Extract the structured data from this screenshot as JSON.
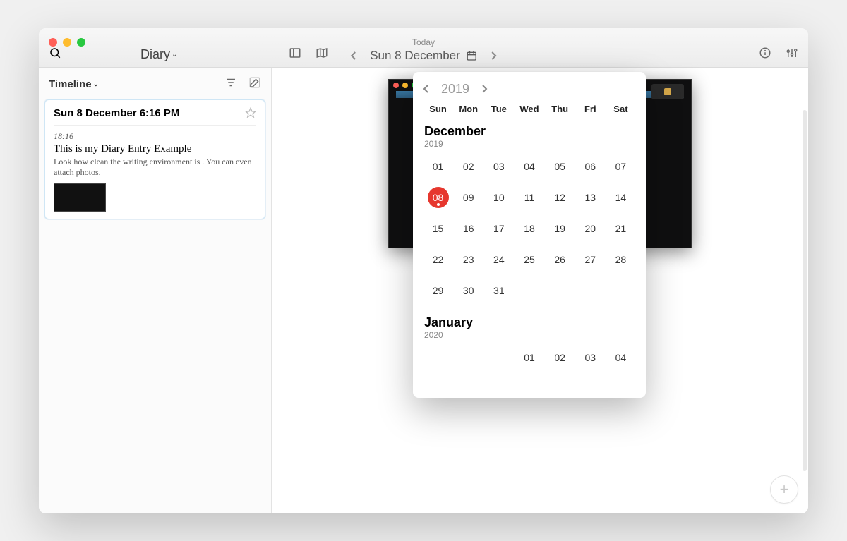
{
  "toolbar": {
    "diary_label": "Diary",
    "today_label": "Today",
    "date_display": "Sun 8 December"
  },
  "sidebar": {
    "view_label": "Timeline"
  },
  "entry": {
    "header": "Sun 8 December 6:16 PM",
    "time": "18:16",
    "title": "This is my Diary Entry Example",
    "excerpt": "Look how clean the writing environment is . You can even attach photos."
  },
  "calendar": {
    "year": "2019",
    "dow": [
      "Sun",
      "Mon",
      "Tue",
      "Wed",
      "Thu",
      "Fri",
      "Sat"
    ],
    "months": [
      {
        "name": "December",
        "year": "2019",
        "leading_blanks": 0,
        "days": [
          "01",
          "02",
          "03",
          "04",
          "05",
          "06",
          "07",
          "08",
          "09",
          "10",
          "11",
          "12",
          "13",
          "14",
          "15",
          "16",
          "17",
          "18",
          "19",
          "20",
          "21",
          "22",
          "23",
          "24",
          "25",
          "26",
          "27",
          "28",
          "29",
          "30",
          "31"
        ],
        "selected": "08"
      },
      {
        "name": "January",
        "year": "2020",
        "leading_blanks": 3,
        "days": [
          "01",
          "02",
          "03",
          "04"
        ],
        "selected": null
      }
    ]
  }
}
